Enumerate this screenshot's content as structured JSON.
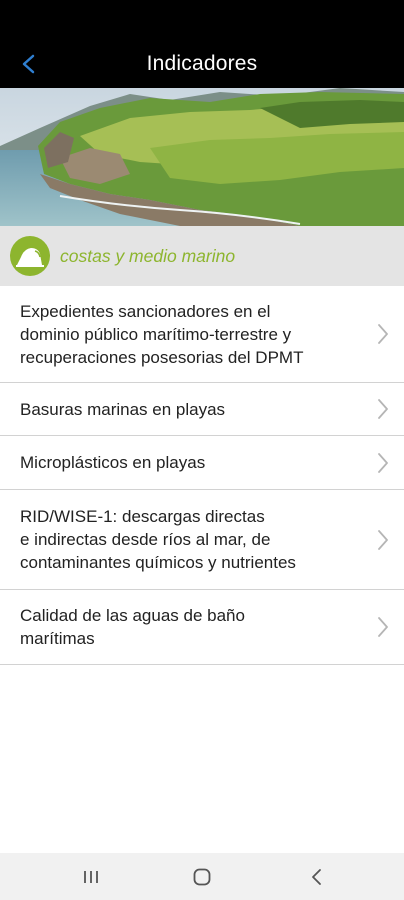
{
  "appbar": {
    "title": "Indicadores",
    "back_icon": "back-arrow-icon",
    "icon_color": "#2f7fd1"
  },
  "hero": {
    "image": "coastal-cliffs-landscape"
  },
  "category": {
    "label": "costas y medio marino",
    "icon": "coast-icon",
    "color": "#8db52e"
  },
  "indicators": [
    {
      "label": "Expedientes sancionadores en el\ndominio público marítimo-terrestre y\nrecuperaciones posesorias del DPMT"
    },
    {
      "label": "Basuras marinas en playas"
    },
    {
      "label": "Microplásticos en playas"
    },
    {
      "label": "RID/WISE-1: descargas directas\ne indirectas desde ríos al mar, de\ncontaminantes químicos y nutrientes"
    },
    {
      "label": "Calidad de las aguas de baño\nmarítimas"
    }
  ],
  "navbar": {
    "recents_icon": "recent-apps-icon",
    "home_icon": "home-icon",
    "back_icon": "nav-back-icon"
  }
}
